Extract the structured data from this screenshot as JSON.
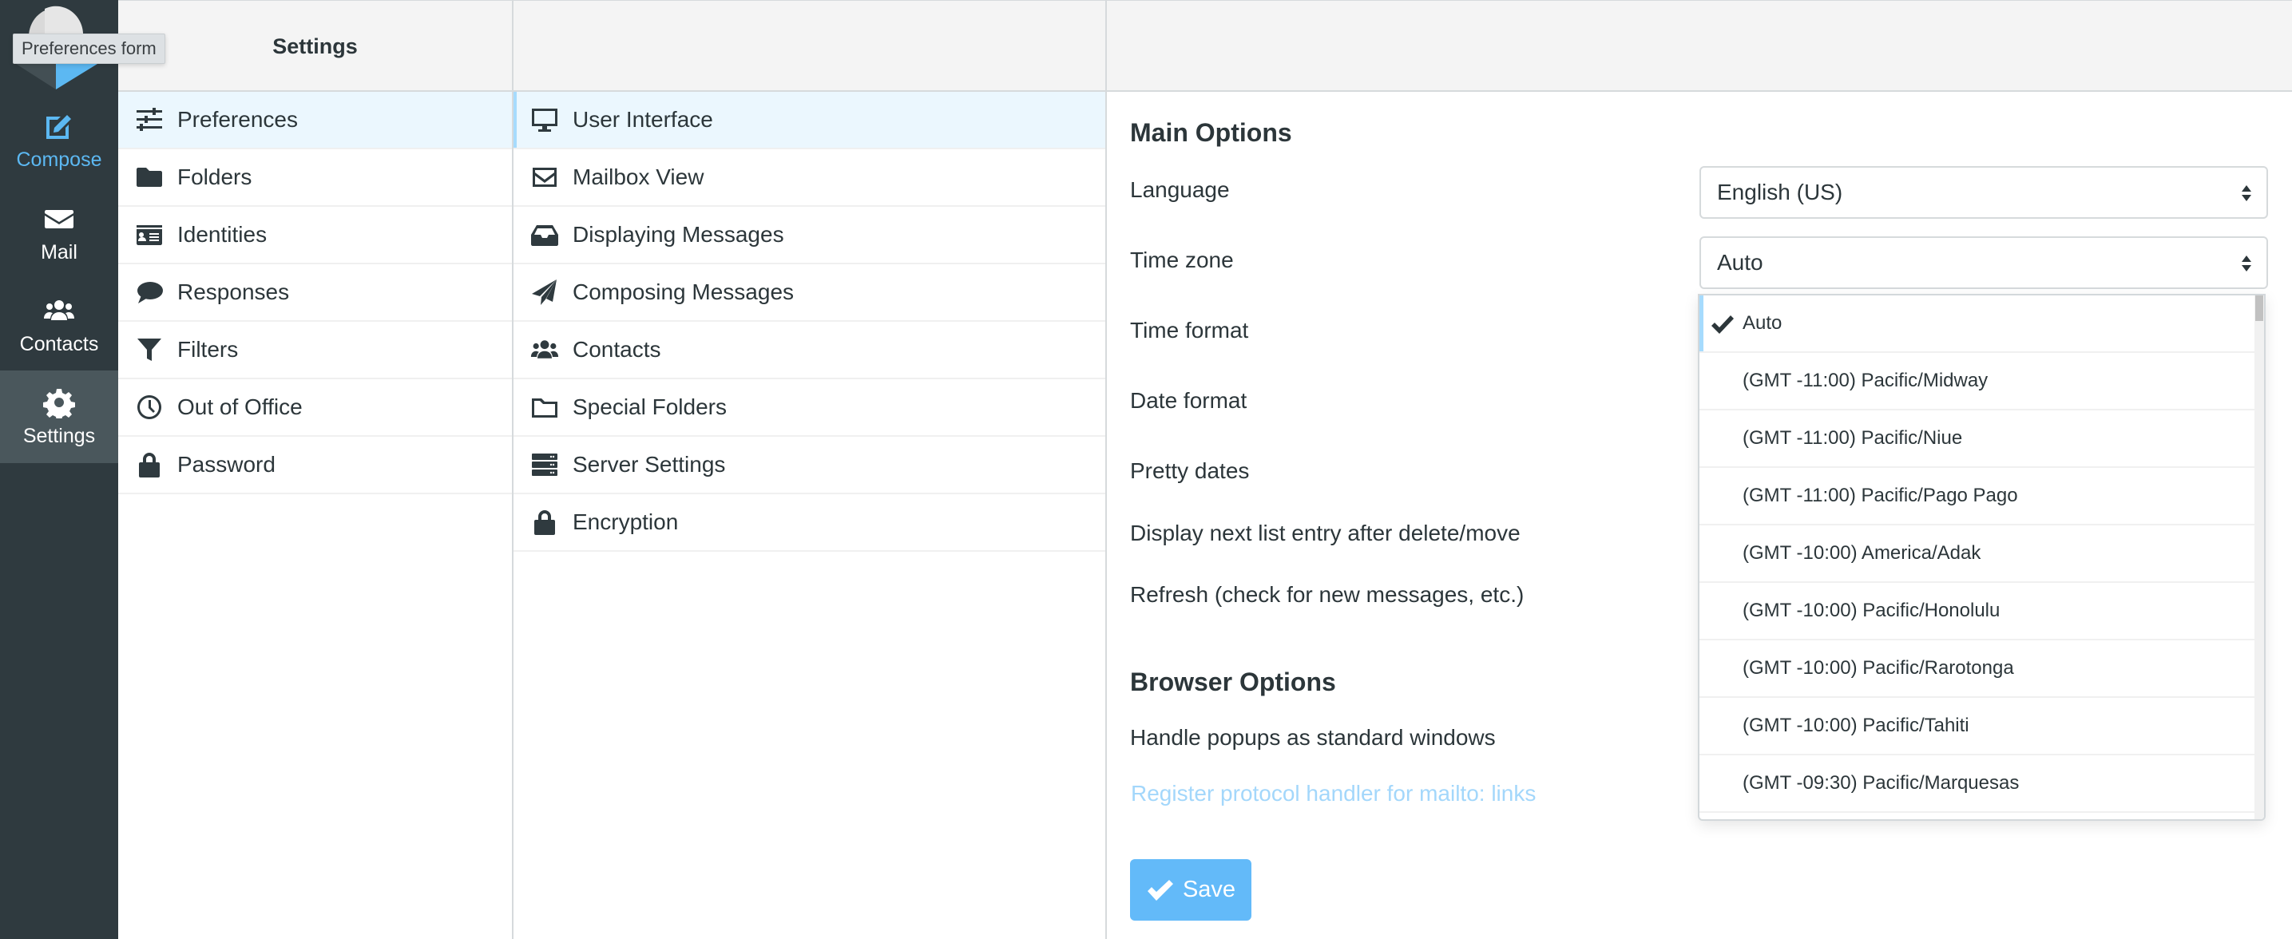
{
  "tooltip": "Preferences form",
  "appnav": {
    "items": [
      {
        "label": "Compose",
        "icon": "compose-icon"
      },
      {
        "label": "Mail",
        "icon": "envelope-icon"
      },
      {
        "label": "Contacts",
        "icon": "users-icon"
      },
      {
        "label": "Settings",
        "icon": "gear-icon",
        "active": true
      }
    ]
  },
  "settings_column": {
    "title": "Settings",
    "items": [
      {
        "label": "Preferences",
        "icon": "sliders-icon",
        "selected": true
      },
      {
        "label": "Folders",
        "icon": "folder-icon"
      },
      {
        "label": "Identities",
        "icon": "id-card-icon"
      },
      {
        "label": "Responses",
        "icon": "comment-icon"
      },
      {
        "label": "Filters",
        "icon": "filter-icon"
      },
      {
        "label": "Out of Office",
        "icon": "clock-icon"
      },
      {
        "label": "Password",
        "icon": "lock-icon"
      }
    ]
  },
  "sections_column": {
    "items": [
      {
        "label": "User Interface",
        "icon": "desktop-icon",
        "selected": true
      },
      {
        "label": "Mailbox View",
        "icon": "envelope-outline-icon"
      },
      {
        "label": "Displaying Messages",
        "icon": "inbox-icon"
      },
      {
        "label": "Composing Messages",
        "icon": "paper-plane-icon"
      },
      {
        "label": "Contacts",
        "icon": "users-icon"
      },
      {
        "label": "Special Folders",
        "icon": "folder-outline-icon"
      },
      {
        "label": "Server Settings",
        "icon": "server-icon"
      },
      {
        "label": "Encryption",
        "icon": "lock-icon"
      }
    ]
  },
  "form": {
    "main_options_title": "Main Options",
    "labels": {
      "language": "Language",
      "timezone": "Time zone",
      "time_format": "Time format",
      "date_format": "Date format",
      "pretty_dates": "Pretty dates",
      "display_next": "Display next list entry after delete/move",
      "refresh": "Refresh (check for new messages, etc.)"
    },
    "language_value": "English (US)",
    "timezone_value": "Auto",
    "browser_options_title": "Browser Options",
    "handle_popups": "Handle popups as standard windows",
    "mailto_link": "Register protocol handler for mailto: links",
    "save_label": "Save"
  },
  "timezone_dropdown": {
    "options": [
      {
        "label": "Auto",
        "checked": true
      },
      {
        "label": "(GMT -11:00) Pacific/Midway"
      },
      {
        "label": "(GMT -11:00) Pacific/Niue"
      },
      {
        "label": "(GMT -11:00) Pacific/Pago Pago"
      },
      {
        "label": "(GMT -10:00) America/Adak"
      },
      {
        "label": "(GMT -10:00) Pacific/Honolulu"
      },
      {
        "label": "(GMT -10:00) Pacific/Rarotonga"
      },
      {
        "label": "(GMT -10:00) Pacific/Tahiti"
      },
      {
        "label": "(GMT -09:30) Pacific/Marquesas"
      }
    ]
  },
  "colors": {
    "nav_bg": "#2f3a3f",
    "nav_active_bg": "#4a575c",
    "accent": "#5cb8f2",
    "selected_row_bg": "#ebf7fe",
    "save_button": "#63baf9",
    "link_disabled": "#a3d7fb"
  }
}
